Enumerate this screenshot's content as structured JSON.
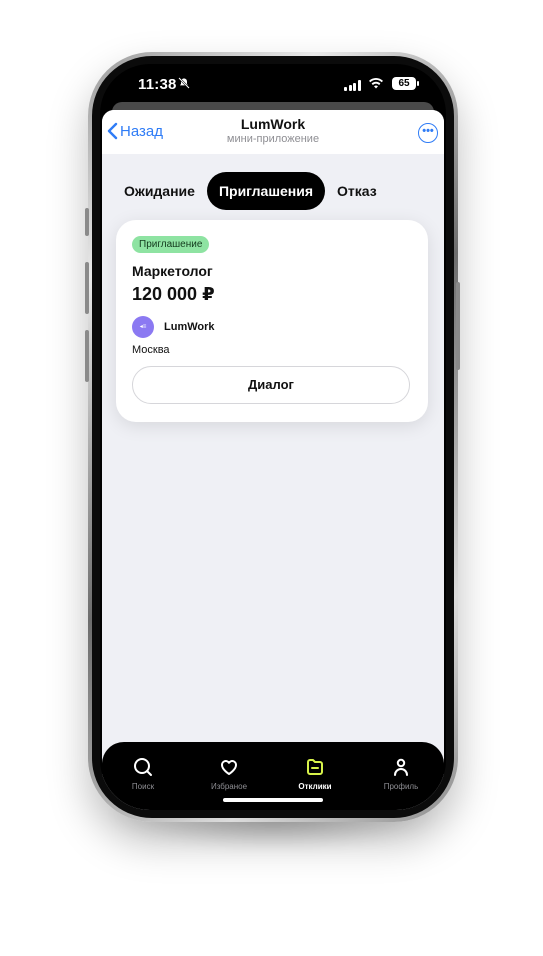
{
  "status_bar": {
    "time": "11:38",
    "battery": "65"
  },
  "nav": {
    "back_label": "Назад",
    "title": "LumWork",
    "subtitle": "мини-приложение"
  },
  "tabs": [
    {
      "label": "Ожидание",
      "active": false
    },
    {
      "label": "Приглашения",
      "active": true
    },
    {
      "label": "Отказ",
      "active": false
    }
  ],
  "card": {
    "badge": "Приглашение",
    "job_title": "Маркетолог",
    "salary": "120 000 ₽",
    "company": "LumWork",
    "city": "Москва",
    "button_label": "Диалог"
  },
  "tabbar": [
    {
      "label": "Поиск",
      "icon": "search-icon",
      "active": false
    },
    {
      "label": "Избраное",
      "icon": "heart-icon",
      "active": false
    },
    {
      "label": "Отклики",
      "icon": "folder-icon",
      "active": true
    },
    {
      "label": "Профиль",
      "icon": "person-icon",
      "active": false
    }
  ],
  "colors": {
    "accent": "#2f7cf6",
    "badge_bg": "#8ee3a2",
    "active_tab_icon": "#d7f24a",
    "background": "#eff0f5"
  }
}
